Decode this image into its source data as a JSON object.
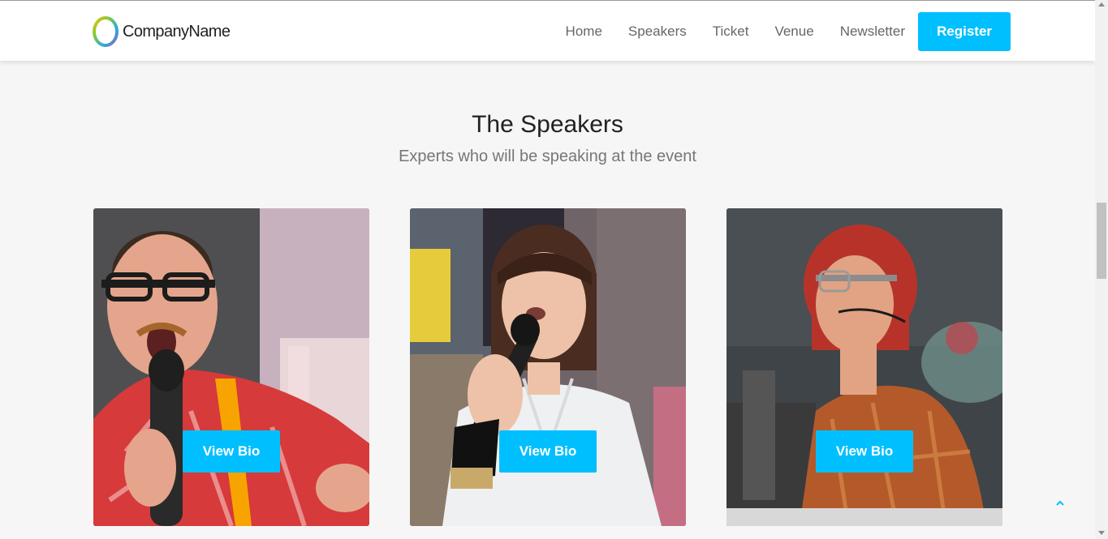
{
  "brand": {
    "name": "CompanyName"
  },
  "nav": {
    "links": [
      {
        "label": "Home"
      },
      {
        "label": "Speakers"
      },
      {
        "label": "Ticket"
      },
      {
        "label": "Venue"
      },
      {
        "label": "Newsletter"
      }
    ],
    "register_label": "Register"
  },
  "speakers_section": {
    "title": "The Speakers",
    "subtitle": "Experts who will be speaking at the event",
    "cards": [
      {
        "button_label": "View Bio"
      },
      {
        "button_label": "View Bio"
      },
      {
        "button_label": "View Bio"
      }
    ]
  },
  "colors": {
    "accent": "#00bfff",
    "background": "#f6f6f6",
    "navbar": "#ffffff"
  },
  "icons": {
    "logo": "ring-logo-icon",
    "back_to_top": "chevron-up-icon"
  }
}
